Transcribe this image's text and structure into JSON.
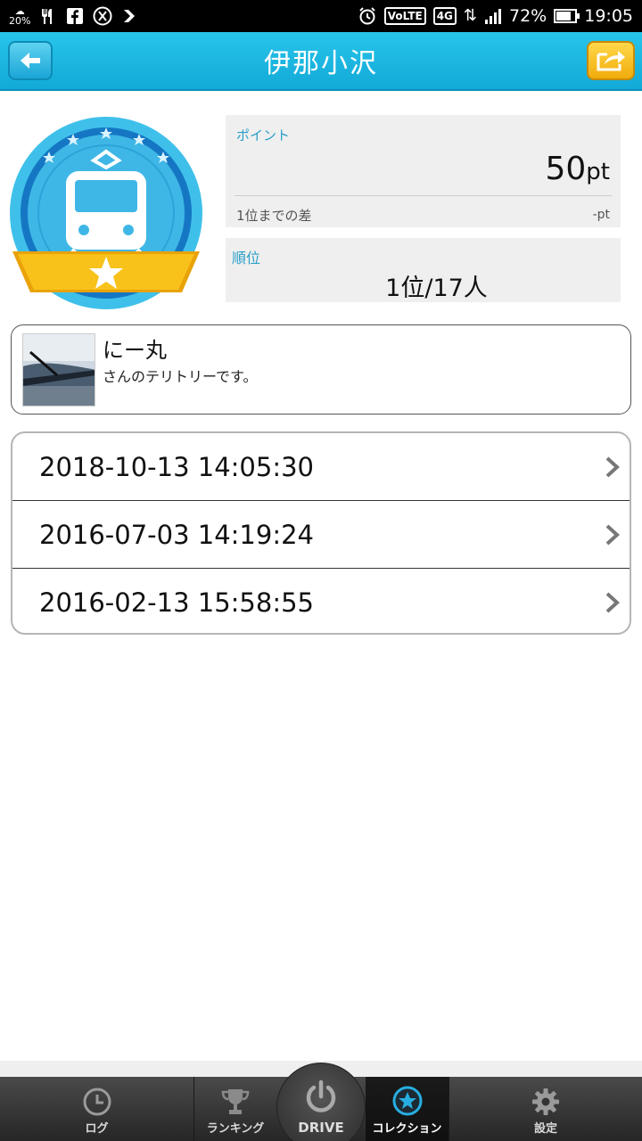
{
  "status_bar": {
    "weather_pct": "20%",
    "network": "4G",
    "volte": "VoLTE",
    "battery": "72%",
    "time": "19:05"
  },
  "header": {
    "title": "伊那小沢",
    "back_icon": "arrow-left-icon",
    "share_icon": "share-icon",
    "bg_color": "#1ab4e0",
    "share_color": "#f5b51b"
  },
  "badge": {
    "icon": "train-icon",
    "stars": 5
  },
  "points": {
    "label": "ポイント",
    "value": "50",
    "unit": "pt",
    "diff_label": "1位までの差",
    "diff_value": "-pt"
  },
  "rank": {
    "label": "順位",
    "value": "1位/17人"
  },
  "territory": {
    "owner_name": "にー丸",
    "message": "さんのテリトリーです。"
  },
  "history": {
    "items": [
      {
        "datetime": "2018-10-13 14:05:30"
      },
      {
        "datetime": "2016-07-03 14:19:24"
      },
      {
        "datetime": "2016-02-13 15:58:55"
      }
    ]
  },
  "nav": {
    "log": "ログ",
    "ranking": "ランキング",
    "drive": "DRIVE",
    "collection": "コレクション",
    "settings": "設定",
    "active": "collection"
  }
}
